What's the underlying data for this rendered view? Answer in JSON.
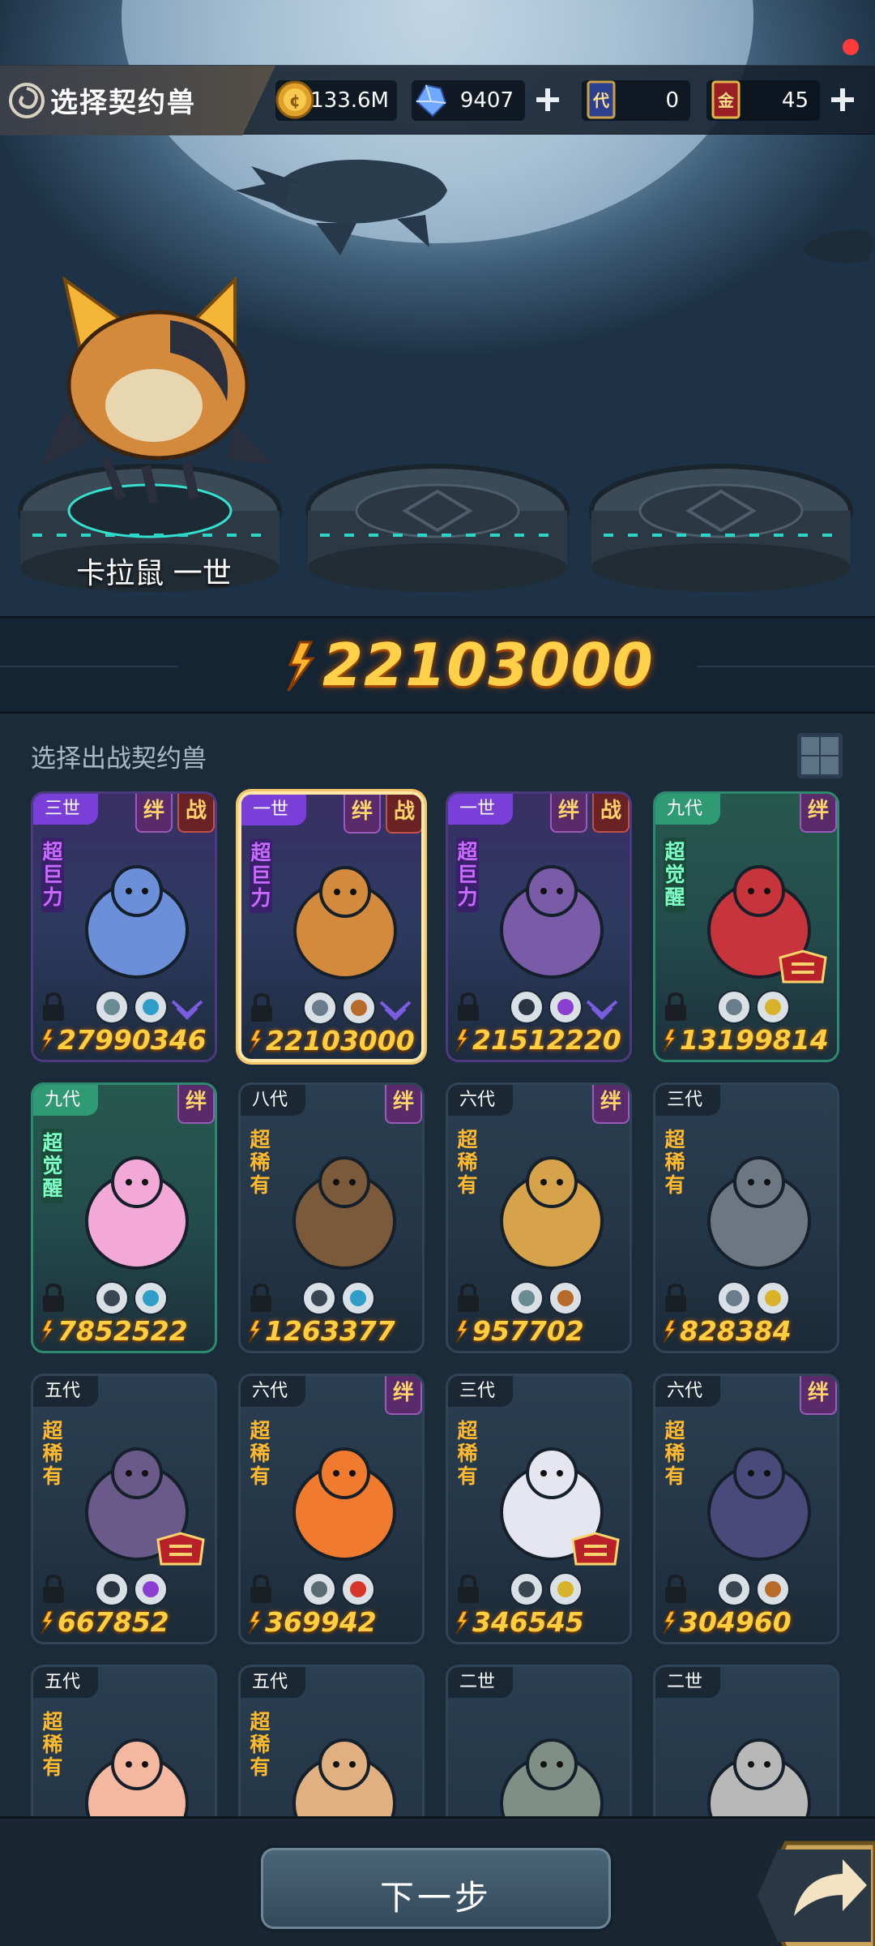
{
  "header": {
    "title": "选择契约兽",
    "title_icon": "swirl-icon",
    "resources": [
      {
        "name": "coin",
        "icon": "gold-coin-icon",
        "value": "133.6M",
        "has_plus": false
      },
      {
        "name": "gem",
        "icon": "blue-crystal-icon",
        "value": "9407",
        "has_plus": true
      },
      {
        "name": "ticket",
        "icon": "blue-card-icon",
        "icon_text": "代",
        "value": "0",
        "has_plus": false
      },
      {
        "name": "gold_card",
        "icon": "red-card-icon",
        "icon_text": "金",
        "value": "45",
        "has_plus": true
      }
    ],
    "plus_glyph": "+"
  },
  "stage": {
    "selected_pet_name": "卡拉鼠 一世",
    "slots": [
      "filled",
      "empty",
      "empty"
    ]
  },
  "total_power": "22103000",
  "list": {
    "label": "选择出战契约兽",
    "view_toggle_icon": "grid-view-icon",
    "cards": [
      {
        "gen": "三世",
        "style": "purple",
        "tags": [
          "绊",
          "战"
        ],
        "rarity": "超巨力",
        "power": "27990346",
        "elements": [
          "leaf-icon",
          "water-drop-icon"
        ],
        "selected": false,
        "has_v_badge": true,
        "has_legend_badge": false
      },
      {
        "gen": "一世",
        "style": "purple",
        "tags": [
          "绊",
          "战"
        ],
        "rarity": "超巨力",
        "power": "22103000",
        "elements": [
          "wind-icon",
          "earth-icon"
        ],
        "selected": true,
        "has_v_badge": true,
        "has_legend_badge": false
      },
      {
        "gen": "一世",
        "style": "purple",
        "tags": [
          "绊",
          "战"
        ],
        "rarity": "超巨力",
        "power": "21512220",
        "elements": [
          "eye-icon",
          "moon-icon"
        ],
        "selected": false,
        "has_v_badge": true,
        "has_legend_badge": false
      },
      {
        "gen": "九代",
        "style": "green",
        "tags": [
          "绊"
        ],
        "rarity": "超觉醒",
        "power": "13199814",
        "elements": [
          "wind-icon",
          "star-icon"
        ],
        "selected": false,
        "has_v_badge": false,
        "has_legend_badge": true
      },
      {
        "gen": "九代",
        "style": "green",
        "tags": [
          "绊"
        ],
        "rarity": "超觉醒",
        "power": "7852522",
        "elements": [
          "shield-icon",
          "water-drop-icon"
        ],
        "selected": false,
        "has_v_badge": false,
        "has_legend_badge": false
      },
      {
        "gen": "八代",
        "style": "normal",
        "tags": [
          "绊"
        ],
        "rarity": "超稀有",
        "power": "1263377",
        "elements": [
          "shield-icon",
          "water-drop-icon"
        ],
        "selected": false,
        "has_v_badge": false,
        "has_legend_badge": false
      },
      {
        "gen": "六代",
        "style": "normal",
        "tags": [
          "绊"
        ],
        "rarity": "超稀有",
        "power": "957702",
        "elements": [
          "leaf-icon",
          "earth-icon"
        ],
        "selected": false,
        "has_v_badge": false,
        "has_legend_badge": false
      },
      {
        "gen": "三代",
        "style": "normal",
        "tags": [],
        "rarity": "超稀有",
        "power": "828384",
        "elements": [
          "wind-icon",
          "star-icon"
        ],
        "selected": false,
        "has_v_badge": false,
        "has_legend_badge": false
      },
      {
        "gen": "五代",
        "style": "normal",
        "tags": [],
        "rarity": "超稀有",
        "power": "667852",
        "elements": [
          "eye-icon",
          "moon-icon"
        ],
        "selected": false,
        "has_v_badge": false,
        "has_legend_badge": true
      },
      {
        "gen": "六代",
        "style": "normal",
        "tags": [
          "绊"
        ],
        "rarity": "超稀有",
        "power": "369942",
        "elements": [
          "sprout-icon",
          "fire-icon"
        ],
        "selected": false,
        "has_v_badge": false,
        "has_legend_badge": false
      },
      {
        "gen": "三代",
        "style": "normal",
        "tags": [],
        "rarity": "超稀有",
        "power": "346545",
        "elements": [
          "crosshair-icon",
          "star-icon"
        ],
        "selected": false,
        "has_v_badge": false,
        "has_legend_badge": true
      },
      {
        "gen": "六代",
        "style": "normal",
        "tags": [
          "绊"
        ],
        "rarity": "超稀有",
        "power": "304960",
        "elements": [
          "shield-icon",
          "earth-icon"
        ],
        "selected": false,
        "has_v_badge": false,
        "has_legend_badge": false
      },
      {
        "gen": "五代",
        "style": "normal",
        "tags": [],
        "rarity": "超稀有",
        "power": "",
        "elements": [],
        "selected": false,
        "has_v_badge": false,
        "has_legend_badge": false
      },
      {
        "gen": "五代",
        "style": "normal",
        "tags": [],
        "rarity": "超稀有",
        "power": "",
        "elements": [],
        "selected": false,
        "has_v_badge": false,
        "has_legend_badge": false
      },
      {
        "gen": "二世",
        "style": "normal",
        "tags": [],
        "rarity": "",
        "power": "",
        "elements": [],
        "selected": false,
        "has_v_badge": false,
        "has_legend_badge": false
      },
      {
        "gen": "二世",
        "style": "normal",
        "tags": [],
        "rarity": "",
        "power": "",
        "elements": [],
        "selected": false,
        "has_v_badge": false,
        "has_legend_badge": false
      }
    ]
  },
  "footer": {
    "next_label": "下一步",
    "share_icon": "share-arrow-icon"
  },
  "colors": {
    "power_gold": "#ffcf3f",
    "purple_card": "#7b3fd9",
    "green_card": "#2f9a73",
    "selected_border": "#ffe7a6",
    "notification": "#ff3a3a"
  }
}
